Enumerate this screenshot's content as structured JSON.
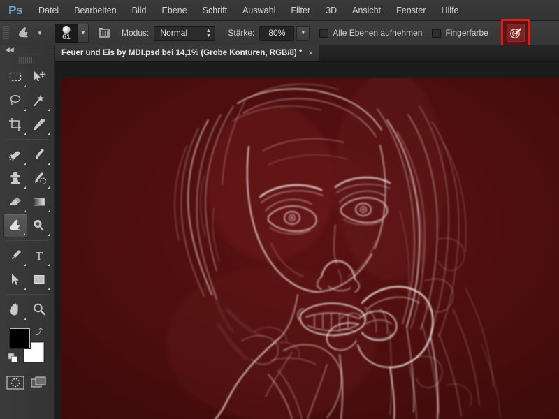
{
  "app": {
    "logo": "Ps",
    "accent_red": "#e01b1b",
    "chrome_bg": "#353535",
    "canvas_bg": "#1c1c1c"
  },
  "menubar": {
    "items": [
      {
        "label": "Datei",
        "name": "menu-datei"
      },
      {
        "label": "Bearbeiten",
        "name": "menu-bearbeiten"
      },
      {
        "label": "Bild",
        "name": "menu-bild"
      },
      {
        "label": "Ebene",
        "name": "menu-ebene"
      },
      {
        "label": "Schrift",
        "name": "menu-schrift"
      },
      {
        "label": "Auswahl",
        "name": "menu-auswahl"
      },
      {
        "label": "Filter",
        "name": "menu-filter"
      },
      {
        "label": "3D",
        "name": "menu-3d"
      },
      {
        "label": "Ansicht",
        "name": "menu-ansicht"
      },
      {
        "label": "Fenster",
        "name": "menu-fenster"
      },
      {
        "label": "Hilfe",
        "name": "menu-hilfe"
      }
    ]
  },
  "options": {
    "tool_icon": "smudge-tool-icon",
    "brush_size": "61",
    "brush_panel_icon": "brush-panel-icon",
    "mode_label": "Modus:",
    "mode_value": "Normal",
    "strength_label": "Stärke:",
    "strength_value": "80%",
    "sample_all_layers_label": "Alle Ebenen aufnehmen",
    "sample_all_layers_checked": false,
    "finger_paint_label": "Fingerfarbe",
    "finger_paint_checked": false,
    "pressure_button_icon": "tablet-pressure-size-icon",
    "pressure_button_highlighted": true,
    "highlight_color": "#e01b1b"
  },
  "document": {
    "tab_title": "Feuer und Eis by MDI.psd bei 14,1% (Grobe Konturen, RGB/8) *",
    "close_glyph": "×",
    "zoom": "14,1%",
    "color_mode": "RGB/8",
    "layer_name": "Grobe Konturen",
    "modified": true
  },
  "toolbar": {
    "collapse_glyph": "◀◀",
    "groups": [
      {
        "tools": [
          {
            "name": "marquee-tool-icon",
            "label": "Auswahlrechteck"
          },
          {
            "name": "move-tool-icon",
            "label": "Verschieben"
          },
          {
            "name": "lasso-tool-icon",
            "label": "Lasso"
          },
          {
            "name": "magic-wand-tool-icon",
            "label": "Zauberstab"
          },
          {
            "name": "crop-tool-icon",
            "label": "Freistellen"
          },
          {
            "name": "eyedropper-tool-icon",
            "label": "Pipette"
          }
        ]
      },
      {
        "tools": [
          {
            "name": "healing-brush-tool-icon",
            "label": "Reparatur-Pinsel"
          },
          {
            "name": "brush-tool-icon",
            "label": "Pinsel"
          },
          {
            "name": "clone-stamp-tool-icon",
            "label": "Kopierstempel"
          },
          {
            "name": "history-brush-tool-icon",
            "label": "Protokollpinsel"
          },
          {
            "name": "eraser-tool-icon",
            "label": "Radiergummi"
          },
          {
            "name": "gradient-tool-icon",
            "label": "Verlauf"
          },
          {
            "name": "smudge-tool-icon",
            "label": "Wischfinger",
            "active": true
          },
          {
            "name": "dodge-tool-icon",
            "label": "Abwedler"
          }
        ]
      },
      {
        "tools": [
          {
            "name": "pen-tool-icon",
            "label": "Zeichenstift"
          },
          {
            "name": "type-tool-icon",
            "label": "Text"
          },
          {
            "name": "path-selection-tool-icon",
            "label": "Pfadauswahl"
          },
          {
            "name": "rectangle-tool-icon",
            "label": "Rechteck"
          }
        ]
      },
      {
        "tools": [
          {
            "name": "hand-tool-icon",
            "label": "Hand"
          },
          {
            "name": "zoom-tool-icon",
            "label": "Zoom"
          }
        ]
      }
    ],
    "foreground_color": "#000000",
    "background_color": "#ffffff",
    "swap_icon": "swap-colors-icon",
    "default_colors_icon": "default-colors-icon",
    "quick_mask_icon": "quick-mask-icon",
    "screen_mode_icon": "screen-mode-icon"
  },
  "artwork": {
    "title": "Feuer und Eis",
    "description": "glowing-edges portrait of a woman on dark red background",
    "base_color": "#4a0d0d",
    "edge_color": "#f3e2e2"
  }
}
